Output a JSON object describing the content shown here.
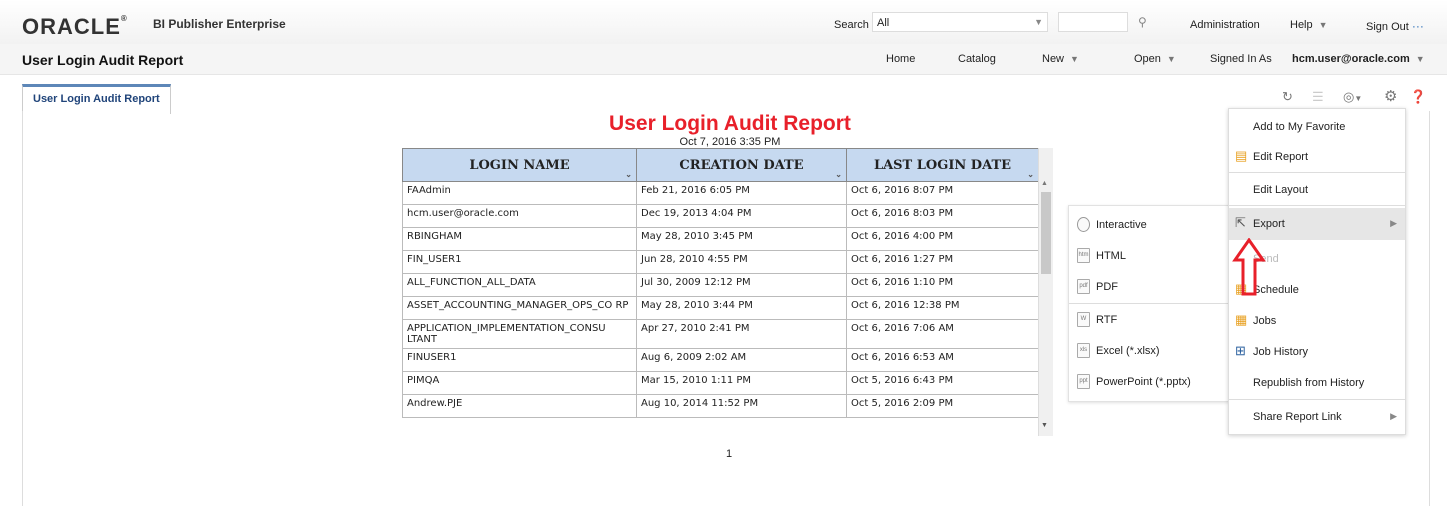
{
  "header": {
    "logo": "ORACLE",
    "logo_mark": "®",
    "product": "BI Publisher Enterprise",
    "search_label": "Search",
    "search_scope": "All",
    "links": {
      "administration": "Administration",
      "help": "Help",
      "sign_out": "Sign Out",
      "more": "···"
    }
  },
  "subheader": {
    "title": "User Login Audit Report",
    "home": "Home",
    "catalog": "Catalog",
    "new": "New",
    "open": "Open",
    "signed_in_as": "Signed In As",
    "user": "hcm.user@oracle.com"
  },
  "tab": {
    "label": "User Login Audit Report"
  },
  "report": {
    "title": "User Login Audit Report",
    "date": "Oct 7, 2016 3:35 PM",
    "columns": [
      "LOGIN NAME",
      "CREATION DATE",
      "LAST LOGIN DATE"
    ],
    "rows": [
      [
        "FAAdmin",
        "Feb 21, 2016 6:05 PM",
        "Oct 6, 2016 8:07 PM"
      ],
      [
        "hcm.user@oracle.com",
        "Dec 19, 2013 4:04 PM",
        "Oct 6, 2016 8:03 PM"
      ],
      [
        "RBINGHAM",
        "May 28, 2010 3:45 PM",
        "Oct 6, 2016 4:00 PM"
      ],
      [
        "FIN_USER1",
        "Jun 28, 2010 4:55 PM",
        "Oct 6, 2016 1:27 PM"
      ],
      [
        "ALL_FUNCTION_ALL_DATA",
        "Jul 30, 2009 12:12 PM",
        "Oct 6, 2016 1:10 PM"
      ],
      [
        "ASSET_ACCOUNTING_MANAGER_OPS_CO RP",
        "May 28, 2010 3:44 PM",
        "Oct 6, 2016 12:38 PM"
      ],
      [
        "APPLICATION_IMPLEMENTATION_CONSU LTANT",
        "Apr 27, 2010 2:41 PM",
        "Oct 6, 2016 7:06 AM"
      ],
      [
        "FINUSER1",
        "Aug 6, 2009 2:02 AM",
        "Oct 6, 2016 6:53 AM"
      ],
      [
        "PIMQA",
        "Mar 15, 2010 1:11 PM",
        "Oct 5, 2016 6:43 PM"
      ],
      [
        "Andrew.PJE",
        "Aug 10, 2014 11:52 PM",
        "Oct 5, 2016 2:09 PM"
      ]
    ],
    "page": "1"
  },
  "export_menu": {
    "interactive": "Interactive",
    "html": "HTML",
    "pdf": "PDF",
    "rtf": "RTF",
    "excel": "Excel (*.xlsx)",
    "powerpoint": "PowerPoint (*.pptx)"
  },
  "action_menu": {
    "add_favorite": "Add to My Favorite",
    "edit_report": "Edit Report",
    "edit_layout": "Edit Layout",
    "export": "Export",
    "send": "Send",
    "schedule": "Schedule",
    "jobs": "Jobs",
    "job_history": "Job History",
    "republish": "Republish from History",
    "share": "Share Report Link"
  },
  "colors": {
    "title_red": "#e8202a",
    "header_blue": "#c6d9f0",
    "arrow_red": "#e8202a"
  }
}
